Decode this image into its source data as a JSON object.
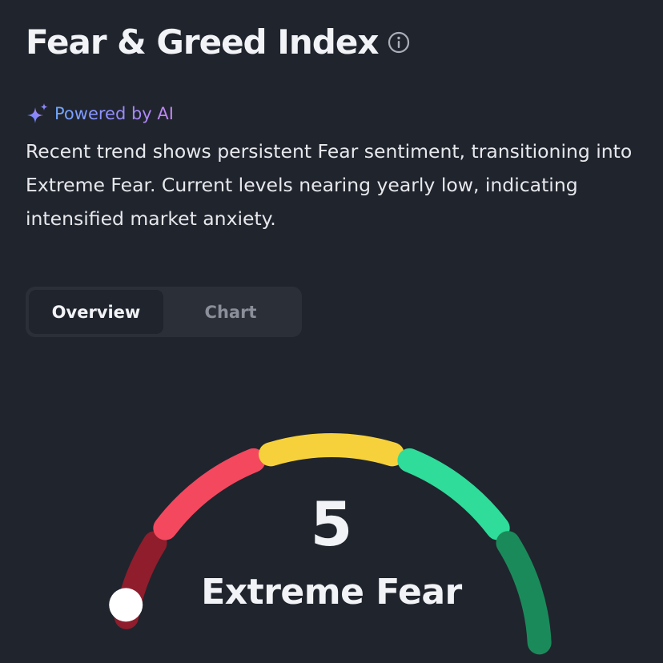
{
  "header": {
    "title": "Fear & Greed Index",
    "info_icon": "info-icon"
  },
  "ai": {
    "powered_label": "Powered by AI",
    "icon": "sparkle-icon",
    "summary": "Recent trend shows persistent Fear sentiment, transitioning into Extreme Fear. Current levels nearing yearly low, indicating intensified market anxiety."
  },
  "tabs": [
    {
      "label": "Overview",
      "active": true
    },
    {
      "label": "Chart",
      "active": false
    }
  ],
  "gauge": {
    "value": "5",
    "value_number": 5,
    "min": 0,
    "max": 100,
    "label": "Extreme Fear",
    "segments": [
      {
        "name": "extreme-fear",
        "color": "#8f1d2c"
      },
      {
        "name": "fear",
        "color": "#f4485f"
      },
      {
        "name": "neutral",
        "color": "#f6d13b"
      },
      {
        "name": "greed",
        "color": "#2fdc9a"
      },
      {
        "name": "extreme-greed",
        "color": "#1b8a5a"
      }
    ],
    "indicator_color": "#ffffff"
  }
}
